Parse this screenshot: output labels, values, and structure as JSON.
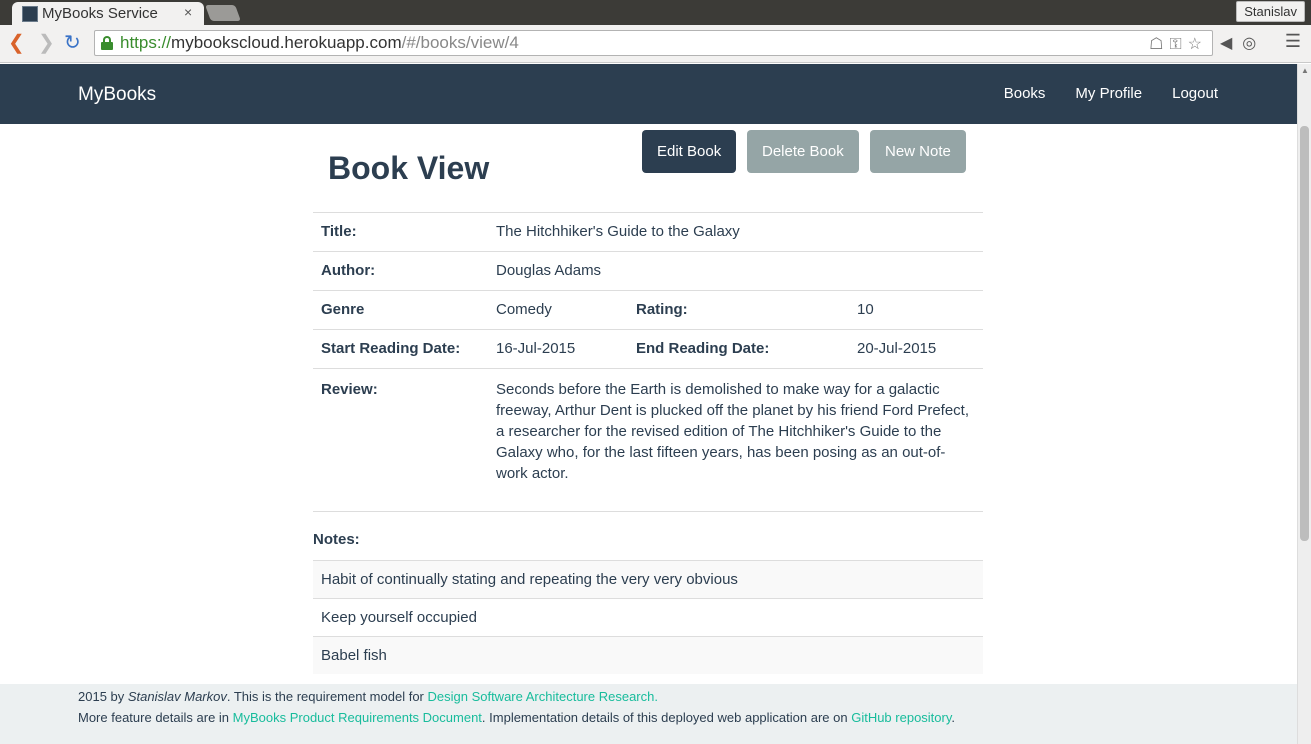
{
  "browser": {
    "tab_title": "MyBooks Service",
    "tab_close": "×",
    "user": "Stanislav",
    "url_scheme": "https://",
    "url_host": "mybookscloud.herokuapp.com",
    "url_path": "/#/books/view/4"
  },
  "nav": {
    "brand": "MyBooks",
    "links": [
      "Books",
      "My Profile",
      "Logout"
    ]
  },
  "page": {
    "title": "Book View",
    "buttons": {
      "edit": "Edit Book",
      "delete": "Delete Book",
      "new_note": "New Note"
    }
  },
  "book": {
    "title_label": "Title:",
    "title": "The Hitchhiker's Guide to the Galaxy",
    "author_label": "Author:",
    "author": "Douglas Adams",
    "genre_label": "Genre",
    "genre": "Comedy",
    "rating_label": "Rating:",
    "rating": "10",
    "start_label": "Start Reading Date:",
    "start": "16-Jul-2015",
    "end_label": "End Reading Date:",
    "end": "20-Jul-2015",
    "review_label": "Review:",
    "review": "Seconds before the Earth is demolished to make way for a galactic freeway, Arthur Dent is plucked off the planet by his friend Ford Prefect, a researcher for the revised edition of The Hitchhiker's Guide to the Galaxy who, for the last fifteen years, has been posing as an out-of-work actor."
  },
  "notes": {
    "label": "Notes:",
    "items": [
      "Habit of continually stating and repeating the very very obvious",
      "Keep yourself occupied",
      "Babel fish"
    ]
  },
  "footer": {
    "year_by": "2015 by ",
    "author": "Stanislav Markov",
    "line1_text": ". This is the requirement model for ",
    "line1_link": "Design Software Architecture Research.",
    "line2_text1": "More feature details are in ",
    "line2_link1": "MyBooks Product Requirements Document",
    "line2_text2": ". Implementation details of this deployed web application are on ",
    "line2_link2": "GitHub repository",
    "line2_text3": "."
  },
  "icons": {
    "back": "back-arrow-icon",
    "forward": "forward-arrow-icon",
    "reload": "reload-icon",
    "lock": "lock-icon",
    "star": "star-icon",
    "menu": "hamburger-menu-icon"
  },
  "colors": {
    "navbar": "#2c3e50",
    "primary_button": "#2c3e50",
    "secondary_button": "#95a5a6",
    "link": "#18bc9c",
    "footer_bg": "#ecf0f1"
  }
}
